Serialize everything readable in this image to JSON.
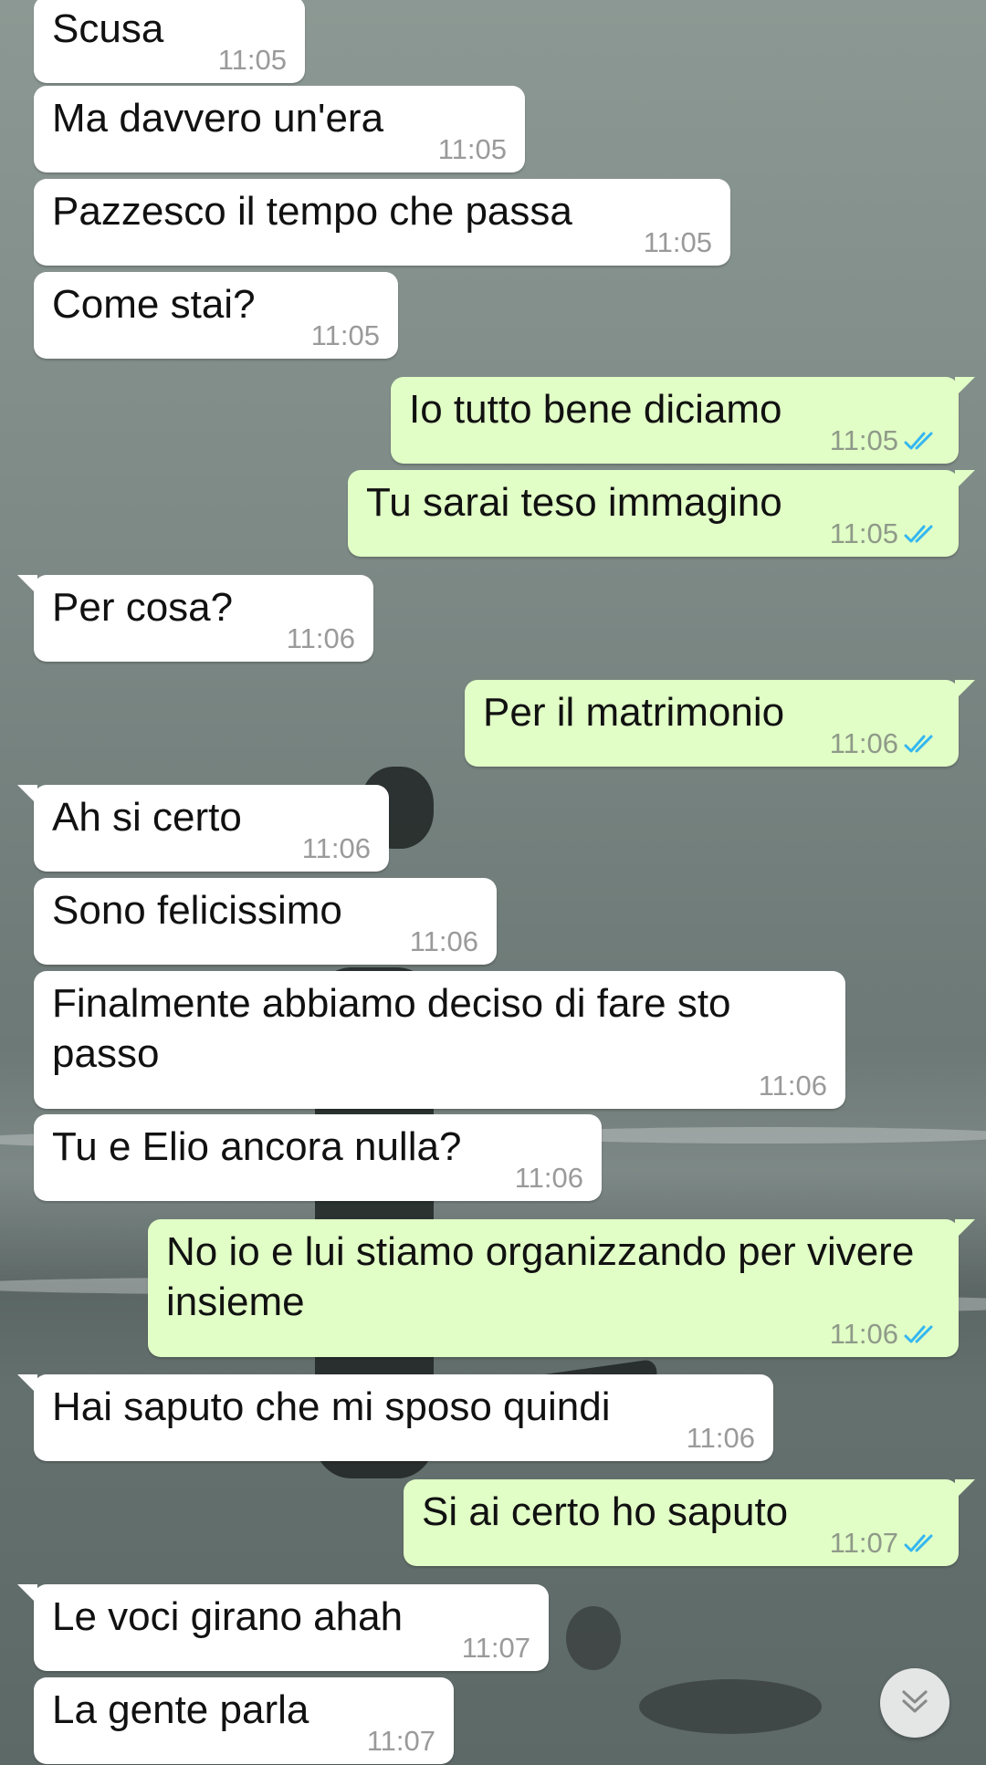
{
  "chat": {
    "messages": [
      {
        "dir": "in",
        "text": "Scusa",
        "time": "11:05"
      },
      {
        "dir": "in",
        "text": "Ma davvero un'era",
        "time": "11:05"
      },
      {
        "dir": "in",
        "text": "Pazzesco il tempo che passa",
        "time": "11:05"
      },
      {
        "dir": "in",
        "text": "Come stai?",
        "time": "11:05"
      },
      {
        "dir": "out",
        "text": "Io tutto bene diciamo",
        "time": "11:05",
        "status": "read"
      },
      {
        "dir": "out",
        "text": "Tu sarai teso immagino",
        "time": "11:05",
        "status": "read"
      },
      {
        "dir": "in",
        "text": "Per cosa?",
        "time": "11:06"
      },
      {
        "dir": "out",
        "text": "Per il matrimonio",
        "time": "11:06",
        "status": "read"
      },
      {
        "dir": "in",
        "text": "Ah si certo",
        "time": "11:06"
      },
      {
        "dir": "in",
        "text": "Sono felicissimo",
        "time": "11:06"
      },
      {
        "dir": "in",
        "text": "Finalmente abbiamo deciso di fare sto\npasso",
        "time": "11:06"
      },
      {
        "dir": "in",
        "text": "Tu e Elio ancora nulla?",
        "time": "11:06"
      },
      {
        "dir": "out",
        "text": "No io e lui stiamo organizzando per vivere\ninsieme",
        "time": "11:06",
        "status": "read"
      },
      {
        "dir": "in",
        "text": "Hai saputo che mi sposo quindi",
        "time": "11:06"
      },
      {
        "dir": "out",
        "text": "Si ai certo ho saputo",
        "time": "11:07",
        "status": "read"
      },
      {
        "dir": "in",
        "text": "Le voci girano ahah",
        "time": "11:07"
      },
      {
        "dir": "in",
        "text": "La gente parla",
        "time": "11:07"
      }
    ]
  },
  "scroll_button": {
    "icon": "double-chevron-down-icon"
  },
  "colors": {
    "incoming_bubble": "#ffffff",
    "outgoing_bubble": "#e1fec6",
    "read_ticks": "#34b7f1",
    "timestamp": "#9a9a9a"
  }
}
